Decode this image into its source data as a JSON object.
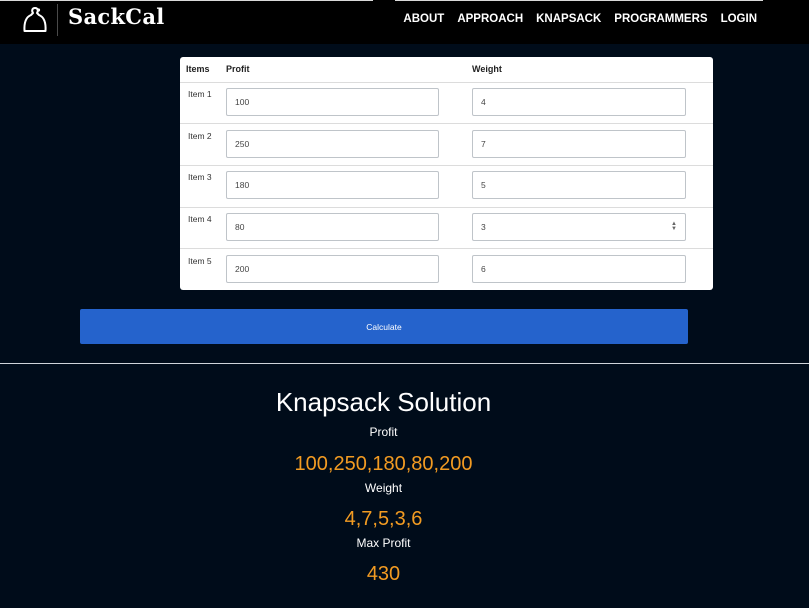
{
  "navbar": {
    "brand": "SackCal",
    "links": [
      "ABOUT",
      "APPROACH",
      "KNAPSACK",
      "PROGRAMMERS",
      "LOGIN"
    ]
  },
  "table": {
    "headers": {
      "items": "Items",
      "profit": "Profit",
      "weight": "Weight"
    },
    "rows": [
      {
        "label": "Item 1",
        "profit": "100",
        "weight": "4"
      },
      {
        "label": "Item 2",
        "profit": "250",
        "weight": "7"
      },
      {
        "label": "Item 3",
        "profit": "180",
        "weight": "5"
      },
      {
        "label": "Item 4",
        "profit": "80",
        "weight": "3"
      },
      {
        "label": "Item 5",
        "profit": "200",
        "weight": "6"
      }
    ]
  },
  "calculate_label": "Calculate",
  "solution": {
    "title": "Knapsack Solution",
    "profit_label": "Profit",
    "profit_value": "100,250,180,80,200",
    "weight_label": "Weight",
    "weight_value": "4,7,5,3,6",
    "max_profit_label": "Max Profit",
    "max_profit_value": "430"
  },
  "colors": {
    "accent": "#2563cc",
    "result": "#f29b22",
    "background": "#000c1a"
  }
}
